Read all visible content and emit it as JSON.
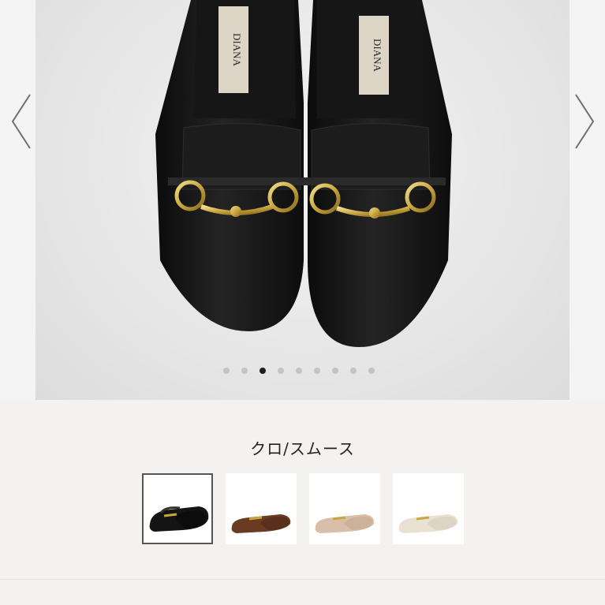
{
  "product": {
    "brand_logo": "DIANA",
    "color_name": "クロ/スムース",
    "colors": {
      "black": "#141414",
      "brown": "#6b3a22",
      "beige": "#d9bfa8",
      "ivory": "#e9e1d2",
      "gold": "#c9a640"
    }
  },
  "carousel": {
    "prev_icon": "chevron-left-icon",
    "next_icon": "chevron-right-icon",
    "total_slides": 9,
    "active_slide": 3
  },
  "swatches": [
    {
      "name": "black",
      "selected": true
    },
    {
      "name": "brown",
      "selected": false
    },
    {
      "name": "beige",
      "selected": false
    },
    {
      "name": "ivory",
      "selected": false
    }
  ]
}
